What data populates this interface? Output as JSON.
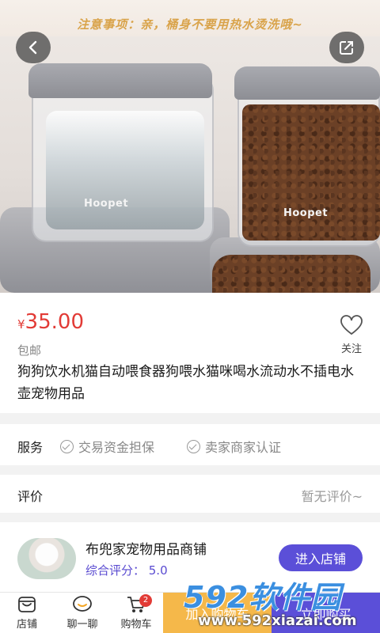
{
  "hero": {
    "notice": "注意事项：亲，桶身不要用热水烫洗哦~",
    "brand_mark": "Hoopet"
  },
  "product": {
    "currency": "¥",
    "price": "35.00",
    "shipping": "包邮",
    "follow_label": "关注",
    "title": "狗狗饮水机猫自动喂食器狗喂水猫咪喝水流动水不插电水壶宠物用品"
  },
  "service": {
    "label": "服务",
    "items": [
      "交易资金担保",
      "卖家商家认证"
    ]
  },
  "review": {
    "label": "评价",
    "value": "暂无评价~"
  },
  "shop": {
    "name": "布兜家宠物用品商铺",
    "score": "综合评分：  5.0",
    "enter_label": "进入店铺"
  },
  "bottom_bar": {
    "tabs": [
      {
        "label": "店铺",
        "icon": "shop-icon"
      },
      {
        "label": "聊一聊",
        "icon": "chat-icon"
      },
      {
        "label": "购物车",
        "icon": "cart-icon"
      }
    ],
    "cart_count": "2",
    "add_to_cart": "加入购物车",
    "buy_now": "立即购买"
  },
  "watermark": {
    "brand": "592软件园",
    "url": "www.592xiazai.com"
  },
  "colors": {
    "price": "#e23b36",
    "accent": "#5b4fd8",
    "add_cart": "#f5b84a"
  }
}
